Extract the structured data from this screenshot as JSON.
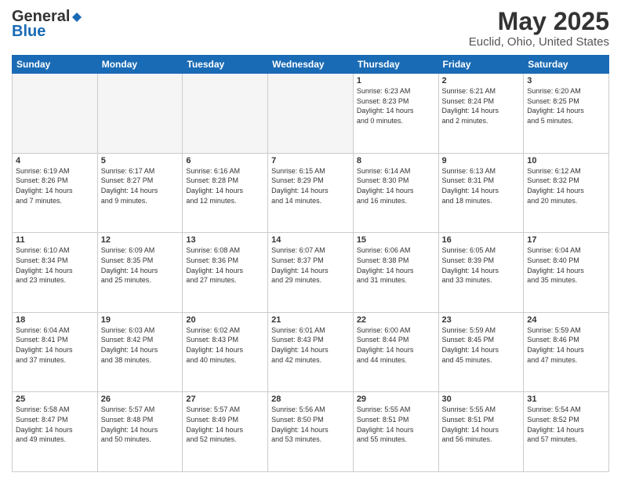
{
  "header": {
    "logo_general": "General",
    "logo_blue": "Blue",
    "title": "May 2025",
    "subtitle": "Euclid, Ohio, United States"
  },
  "days_of_week": [
    "Sunday",
    "Monday",
    "Tuesday",
    "Wednesday",
    "Thursday",
    "Friday",
    "Saturday"
  ],
  "weeks": [
    [
      {
        "day": "",
        "info": "",
        "empty": true
      },
      {
        "day": "",
        "info": "",
        "empty": true
      },
      {
        "day": "",
        "info": "",
        "empty": true
      },
      {
        "day": "",
        "info": "",
        "empty": true
      },
      {
        "day": "1",
        "info": "Sunrise: 6:23 AM\nSunset: 8:23 PM\nDaylight: 14 hours\nand 0 minutes.",
        "empty": false
      },
      {
        "day": "2",
        "info": "Sunrise: 6:21 AM\nSunset: 8:24 PM\nDaylight: 14 hours\nand 2 minutes.",
        "empty": false
      },
      {
        "day": "3",
        "info": "Sunrise: 6:20 AM\nSunset: 8:25 PM\nDaylight: 14 hours\nand 5 minutes.",
        "empty": false
      }
    ],
    [
      {
        "day": "4",
        "info": "Sunrise: 6:19 AM\nSunset: 8:26 PM\nDaylight: 14 hours\nand 7 minutes.",
        "empty": false
      },
      {
        "day": "5",
        "info": "Sunrise: 6:17 AM\nSunset: 8:27 PM\nDaylight: 14 hours\nand 9 minutes.",
        "empty": false
      },
      {
        "day": "6",
        "info": "Sunrise: 6:16 AM\nSunset: 8:28 PM\nDaylight: 14 hours\nand 12 minutes.",
        "empty": false
      },
      {
        "day": "7",
        "info": "Sunrise: 6:15 AM\nSunset: 8:29 PM\nDaylight: 14 hours\nand 14 minutes.",
        "empty": false
      },
      {
        "day": "8",
        "info": "Sunrise: 6:14 AM\nSunset: 8:30 PM\nDaylight: 14 hours\nand 16 minutes.",
        "empty": false
      },
      {
        "day": "9",
        "info": "Sunrise: 6:13 AM\nSunset: 8:31 PM\nDaylight: 14 hours\nand 18 minutes.",
        "empty": false
      },
      {
        "day": "10",
        "info": "Sunrise: 6:12 AM\nSunset: 8:32 PM\nDaylight: 14 hours\nand 20 minutes.",
        "empty": false
      }
    ],
    [
      {
        "day": "11",
        "info": "Sunrise: 6:10 AM\nSunset: 8:34 PM\nDaylight: 14 hours\nand 23 minutes.",
        "empty": false
      },
      {
        "day": "12",
        "info": "Sunrise: 6:09 AM\nSunset: 8:35 PM\nDaylight: 14 hours\nand 25 minutes.",
        "empty": false
      },
      {
        "day": "13",
        "info": "Sunrise: 6:08 AM\nSunset: 8:36 PM\nDaylight: 14 hours\nand 27 minutes.",
        "empty": false
      },
      {
        "day": "14",
        "info": "Sunrise: 6:07 AM\nSunset: 8:37 PM\nDaylight: 14 hours\nand 29 minutes.",
        "empty": false
      },
      {
        "day": "15",
        "info": "Sunrise: 6:06 AM\nSunset: 8:38 PM\nDaylight: 14 hours\nand 31 minutes.",
        "empty": false
      },
      {
        "day": "16",
        "info": "Sunrise: 6:05 AM\nSunset: 8:39 PM\nDaylight: 14 hours\nand 33 minutes.",
        "empty": false
      },
      {
        "day": "17",
        "info": "Sunrise: 6:04 AM\nSunset: 8:40 PM\nDaylight: 14 hours\nand 35 minutes.",
        "empty": false
      }
    ],
    [
      {
        "day": "18",
        "info": "Sunrise: 6:04 AM\nSunset: 8:41 PM\nDaylight: 14 hours\nand 37 minutes.",
        "empty": false
      },
      {
        "day": "19",
        "info": "Sunrise: 6:03 AM\nSunset: 8:42 PM\nDaylight: 14 hours\nand 38 minutes.",
        "empty": false
      },
      {
        "day": "20",
        "info": "Sunrise: 6:02 AM\nSunset: 8:43 PM\nDaylight: 14 hours\nand 40 minutes.",
        "empty": false
      },
      {
        "day": "21",
        "info": "Sunrise: 6:01 AM\nSunset: 8:43 PM\nDaylight: 14 hours\nand 42 minutes.",
        "empty": false
      },
      {
        "day": "22",
        "info": "Sunrise: 6:00 AM\nSunset: 8:44 PM\nDaylight: 14 hours\nand 44 minutes.",
        "empty": false
      },
      {
        "day": "23",
        "info": "Sunrise: 5:59 AM\nSunset: 8:45 PM\nDaylight: 14 hours\nand 45 minutes.",
        "empty": false
      },
      {
        "day": "24",
        "info": "Sunrise: 5:59 AM\nSunset: 8:46 PM\nDaylight: 14 hours\nand 47 minutes.",
        "empty": false
      }
    ],
    [
      {
        "day": "25",
        "info": "Sunrise: 5:58 AM\nSunset: 8:47 PM\nDaylight: 14 hours\nand 49 minutes.",
        "empty": false
      },
      {
        "day": "26",
        "info": "Sunrise: 5:57 AM\nSunset: 8:48 PM\nDaylight: 14 hours\nand 50 minutes.",
        "empty": false
      },
      {
        "day": "27",
        "info": "Sunrise: 5:57 AM\nSunset: 8:49 PM\nDaylight: 14 hours\nand 52 minutes.",
        "empty": false
      },
      {
        "day": "28",
        "info": "Sunrise: 5:56 AM\nSunset: 8:50 PM\nDaylight: 14 hours\nand 53 minutes.",
        "empty": false
      },
      {
        "day": "29",
        "info": "Sunrise: 5:55 AM\nSunset: 8:51 PM\nDaylight: 14 hours\nand 55 minutes.",
        "empty": false
      },
      {
        "day": "30",
        "info": "Sunrise: 5:55 AM\nSunset: 8:51 PM\nDaylight: 14 hours\nand 56 minutes.",
        "empty": false
      },
      {
        "day": "31",
        "info": "Sunrise: 5:54 AM\nSunset: 8:52 PM\nDaylight: 14 hours\nand 57 minutes.",
        "empty": false
      }
    ]
  ],
  "colors": {
    "header_bg": "#1a6bb5",
    "header_text": "#ffffff",
    "cell_border": "#cccccc",
    "empty_bg": "#f0f0f0"
  }
}
